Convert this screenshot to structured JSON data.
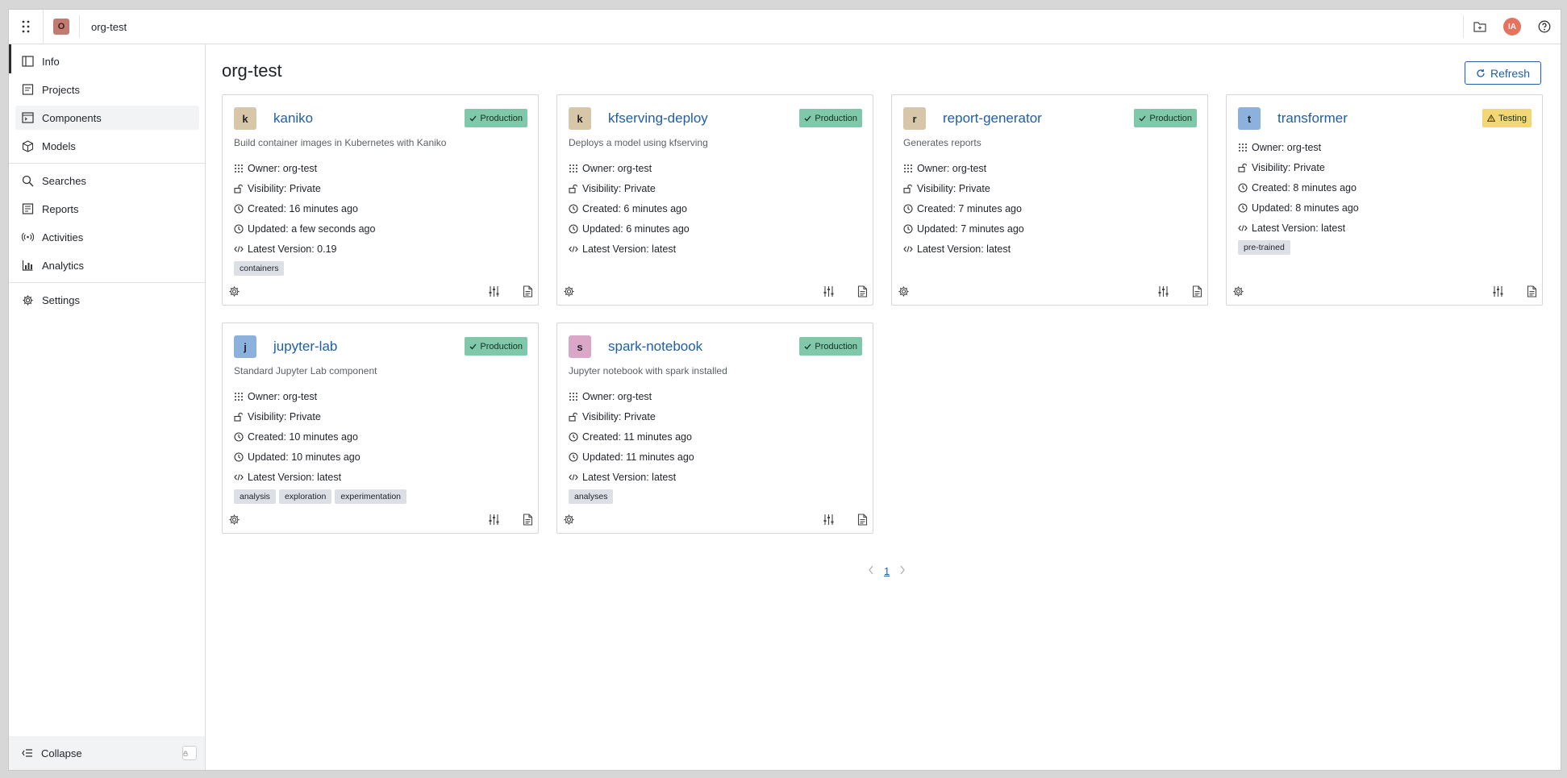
{
  "header": {
    "org_initial": "O",
    "org_name": "org-test",
    "user_initials": "IA"
  },
  "sidebar": {
    "items": [
      {
        "label": "Info",
        "icon": "book-icon"
      },
      {
        "label": "Projects",
        "icon": "file-icon"
      },
      {
        "label": "Components",
        "icon": "terminal-icon"
      },
      {
        "label": "Models",
        "icon": "cube-icon"
      },
      {
        "label": "Searches",
        "icon": "search-icon"
      },
      {
        "label": "Reports",
        "icon": "report-icon"
      },
      {
        "label": "Activities",
        "icon": "broadcast-icon"
      },
      {
        "label": "Analytics",
        "icon": "chart-icon"
      },
      {
        "label": "Settings",
        "icon": "gear-icon"
      }
    ],
    "collapse_label": "Collapse"
  },
  "main": {
    "title": "org-test",
    "refresh_label": "Refresh",
    "cards": [
      {
        "initial": "k",
        "avatar_color": "#d8c6a8",
        "name": "kaniko",
        "status": "Production",
        "description": "Build container images in Kubernetes with Kaniko",
        "owner": "Owner: org-test",
        "visibility": "Visibility: Private",
        "created": "Created: 16 minutes ago",
        "updated": "Updated: a few seconds ago",
        "version": "Latest Version: 0.19",
        "tags": [
          "containers"
        ]
      },
      {
        "initial": "k",
        "avatar_color": "#d8c6a8",
        "name": "kfserving-deploy",
        "status": "Production",
        "description": "Deploys a model using kfserving",
        "owner": "Owner: org-test",
        "visibility": "Visibility: Private",
        "created": "Created: 6 minutes ago",
        "updated": "Updated: 6 minutes ago",
        "version": "Latest Version: latest",
        "tags": []
      },
      {
        "initial": "r",
        "avatar_color": "#d8c6a8",
        "name": "report-generator",
        "status": "Production",
        "description": "Generates reports",
        "owner": "Owner: org-test",
        "visibility": "Visibility: Private",
        "created": "Created: 7 minutes ago",
        "updated": "Updated: 7 minutes ago",
        "version": "Latest Version: latest",
        "tags": []
      },
      {
        "initial": "t",
        "avatar_color": "#8bb1dc",
        "name": "transformer",
        "status": "Testing",
        "description": "",
        "owner": "Owner: org-test",
        "visibility": "Visibility: Private",
        "created": "Created: 8 minutes ago",
        "updated": "Updated: 8 minutes ago",
        "version": "Latest Version: latest",
        "tags": [
          "pre-trained"
        ]
      },
      {
        "initial": "j",
        "avatar_color": "#8bb1dc",
        "name": "jupyter-lab",
        "status": "Production",
        "description": "Standard Jupyter Lab component",
        "owner": "Owner: org-test",
        "visibility": "Visibility: Private",
        "created": "Created: 10 minutes ago",
        "updated": "Updated: 10 minutes ago",
        "version": "Latest Version: latest",
        "tags": [
          "analysis",
          "exploration",
          "experimentation"
        ]
      },
      {
        "initial": "s",
        "avatar_color": "#dba7c8",
        "name": "spark-notebook",
        "status": "Production",
        "description": "Jupyter notebook with spark installed",
        "owner": "Owner: org-test",
        "visibility": "Visibility: Private",
        "created": "Created: 11 minutes ago",
        "updated": "Updated: 11 minutes ago",
        "version": "Latest Version: latest",
        "tags": [
          "analyses"
        ]
      }
    ],
    "pagination": {
      "current": "1"
    }
  },
  "colors": {
    "accent": "#1f5fa8",
    "production": "#7fc8a9",
    "testing": "#f2d774"
  }
}
